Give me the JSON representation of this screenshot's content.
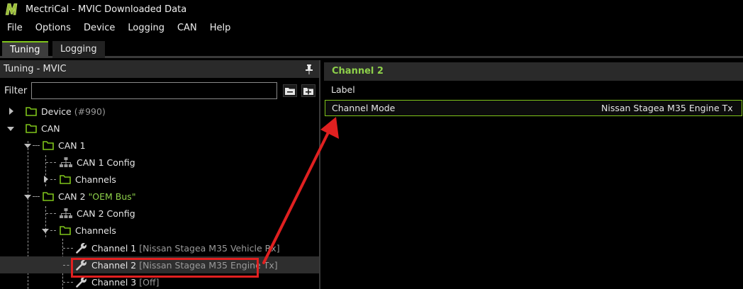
{
  "window": {
    "title": "MectriCal - MVIC Downloaded Data",
    "logo_icon": "mectrical-logo"
  },
  "menu": [
    "File",
    "Options",
    "Device",
    "Logging",
    "CAN",
    "Help"
  ],
  "tabs": {
    "tuning": "Tuning",
    "logging": "Logging"
  },
  "left_panel": {
    "header": "Tuning - MVIC",
    "filter_label": "Filter",
    "filter_value": "",
    "tree": {
      "device": {
        "label": "Device",
        "suffix": "(#990)"
      },
      "can": {
        "label": "CAN"
      },
      "can1": {
        "label": "CAN 1"
      },
      "can1_config": {
        "label": "CAN 1 Config"
      },
      "can1_channels": {
        "label": "Channels"
      },
      "can2": {
        "label": "CAN 2",
        "suffix": "\"OEM Bus\""
      },
      "can2_config": {
        "label": "CAN 2 Config"
      },
      "can2_channels": {
        "label": "Channels"
      },
      "channel1": {
        "label": "Channel 1",
        "suffix": "[Nissan Stagea M35 Vehicle Rx]"
      },
      "channel2": {
        "label": "Channel 2",
        "suffix": "[Nissan Stagea M35 Engine Tx]"
      },
      "channel3": {
        "label": "Channel 3",
        "suffix": "[Off]"
      }
    }
  },
  "right_panel": {
    "header": "Channel 2",
    "properties": {
      "label": {
        "name": "Label",
        "value": ""
      },
      "channel_mode": {
        "name": "Channel Mode",
        "value": "Nissan Stagea M35 Engine Tx"
      }
    }
  },
  "colors": {
    "accent": "#7fc41a",
    "annotation": "#e02020",
    "folder": "#7fc41a"
  }
}
